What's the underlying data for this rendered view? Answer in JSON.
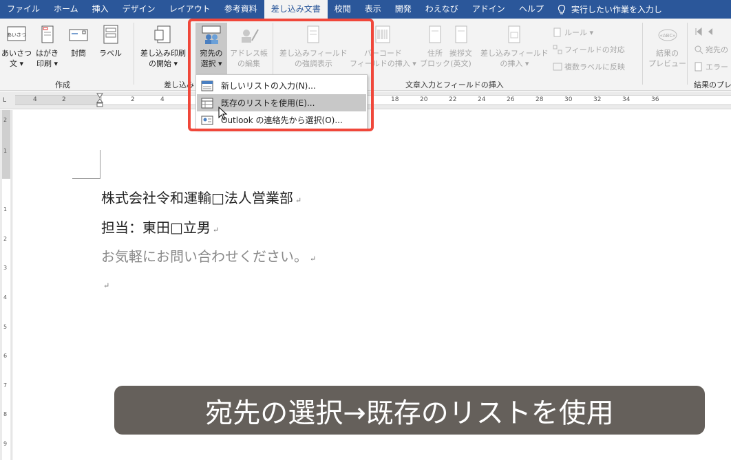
{
  "tabs": [
    "ファイル",
    "ホーム",
    "挿入",
    "デザイン",
    "レイアウト",
    "参考資料",
    "差し込み文書",
    "校閲",
    "表示",
    "開発",
    "わえなび",
    "アドイン",
    "ヘルプ"
  ],
  "active_tab": "差し込み文書",
  "tell_me": "実行したい作業を入力し",
  "ribbon": {
    "create": {
      "greeting_l1": "あいさつ",
      "greeting_l2": "文 ▾",
      "postcard_l1": "はがき",
      "postcard_l2": "印刷 ▾",
      "envelope": "封筒",
      "label": "ラベル",
      "group": "作成",
      "greeting_icon_text": "あいさつ"
    },
    "start": {
      "start_l1": "差し込み印刷",
      "start_l2": "の開始 ▾",
      "recipients_l1": "宛先の",
      "recipients_l2": "選択 ▾",
      "address_l1": "アドレス帳",
      "address_l2": "の編集",
      "group": "差し込み"
    },
    "fields": {
      "highlight_l1": "差し込みフィールド",
      "highlight_l2": "の強調表示",
      "barcode_l1": "バーコード",
      "barcode_l2": "フィールドの挿入 ▾",
      "address_block_l1": "住所",
      "address_block_l2": "ブロック",
      "greeting_line_l1": "挨拶文",
      "greeting_line_l2": "(英文)",
      "insert_field_l1": "差し込みフィールド",
      "insert_field_l2": "の挿入 ▾",
      "rules": "ルール ▾",
      "match_fields": "フィールドの対応",
      "update_labels": "複数ラベルに反映",
      "group": "文章入力とフィールドの挿入"
    },
    "preview": {
      "preview_l1": "結果の",
      "preview_l2": "プレビュー",
      "find_recipient": "宛先の",
      "check_errors": "エラー",
      "group": "結果のプレ",
      "icon_text": "«ABC»"
    }
  },
  "ruler_numbers": [
    "4",
    "2",
    "2",
    "4",
    "18",
    "20",
    "22",
    "24",
    "26",
    "28",
    "30",
    "32",
    "34",
    "36"
  ],
  "vruler_numbers": [
    "2",
    "1",
    "1",
    "2",
    "3",
    "4",
    "5",
    "6",
    "7",
    "8",
    "9"
  ],
  "dropdown": {
    "new_list": "新しいリストの入力(N)...",
    "existing_list": "既存のリストを使用(E)...",
    "outlook": "Outlook の連絡先から選択(O)..."
  },
  "document": {
    "line1": "株式会社令和運輸□法人営業部",
    "line2": "担当：東田□立男",
    "line3": "お気軽にお問い合わせください。",
    "para_mark": "↵"
  },
  "caption": "宛先の選択→既存のリストを使用",
  "colors": {
    "title_bar": "#2b579a",
    "ribbon": "#f3f3f3",
    "highlight": "#f0473a",
    "caption_bg": "#504a44"
  }
}
